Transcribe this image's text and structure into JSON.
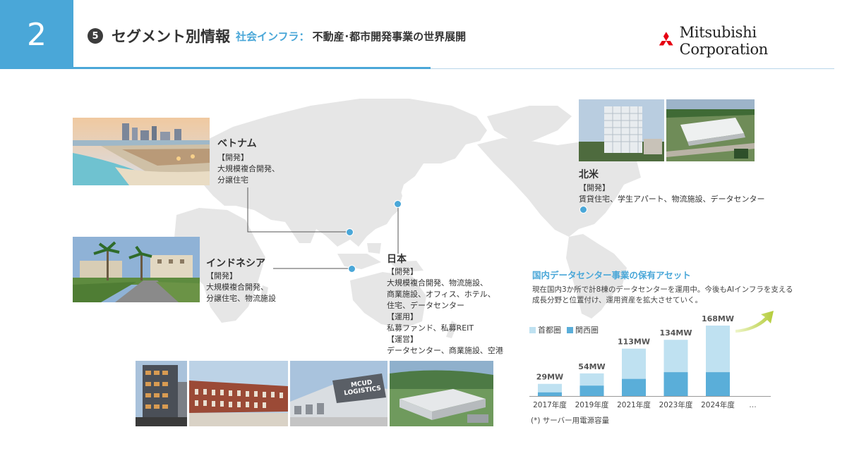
{
  "header": {
    "page_number": "2",
    "section_number": "5",
    "title_main": "セグメント別情報",
    "title_segment": "社会インフラ：",
    "title_sub": "不動産･都市開発事業の世界展開",
    "company": "Mitsubishi Corporation"
  },
  "colors": {
    "accent": "#4aa7d8",
    "light": "#bfe1f1",
    "dark": "#5aaed9",
    "map": "#e6e6e6",
    "logo_red": "#e60012"
  },
  "regions": {
    "vietnam": {
      "name": "ベトナム",
      "lines": [
        "【開発】",
        "大規模複合開発、",
        "分譲住宅"
      ]
    },
    "indonesia": {
      "name": "インドネシア",
      "lines": [
        "【開発】",
        "大規模複合開発、",
        "分譲住宅、物流施設"
      ]
    },
    "japan": {
      "name": "日本",
      "lines": [
        "【開発】",
        "大規模複合開発、物流施設、",
        "商業施設、オフィス、ホテル、",
        "住宅、データセンター",
        "【運用】",
        "私募ファンド、私募REIT",
        "【運営】",
        "データセンター、商業施設、空港"
      ]
    },
    "north_america": {
      "name": "北米",
      "lines": [
        "【開発】",
        "賃貸住宅、学生アパート、物流施設、データセンター"
      ]
    }
  },
  "photos": {
    "mcud_sign": "MCUD LOGISTICS"
  },
  "datacenter": {
    "title": "国内データセンター事業の保有アセット",
    "desc_lines": [
      "現在国内3か所で計8棟のデータセンターを運用中。今後もAIインフラを支える",
      "成長分野と位置付け、運用資産を拡大させていく。"
    ],
    "footnote": "(*) サーバー用電源容量",
    "ellipsis": "…"
  },
  "chart_data": {
    "type": "bar",
    "stacked": true,
    "categories": [
      "2017年度",
      "2019年度",
      "2021年度",
      "2023年度",
      "2024年度"
    ],
    "series": [
      {
        "name": "関西圏",
        "values": [
          9,
          25,
          41,
          57,
          57
        ],
        "color": "#5aaed9"
      },
      {
        "name": "首都圏",
        "values": [
          20,
          29,
          72,
          77,
          111
        ],
        "color": "#bfe1f1"
      }
    ],
    "totals_labels": [
      "29MW",
      "54MW",
      "113MW",
      "134MW",
      "168MW"
    ],
    "ylim": [
      0,
      168
    ],
    "legend_position": "top-left"
  }
}
